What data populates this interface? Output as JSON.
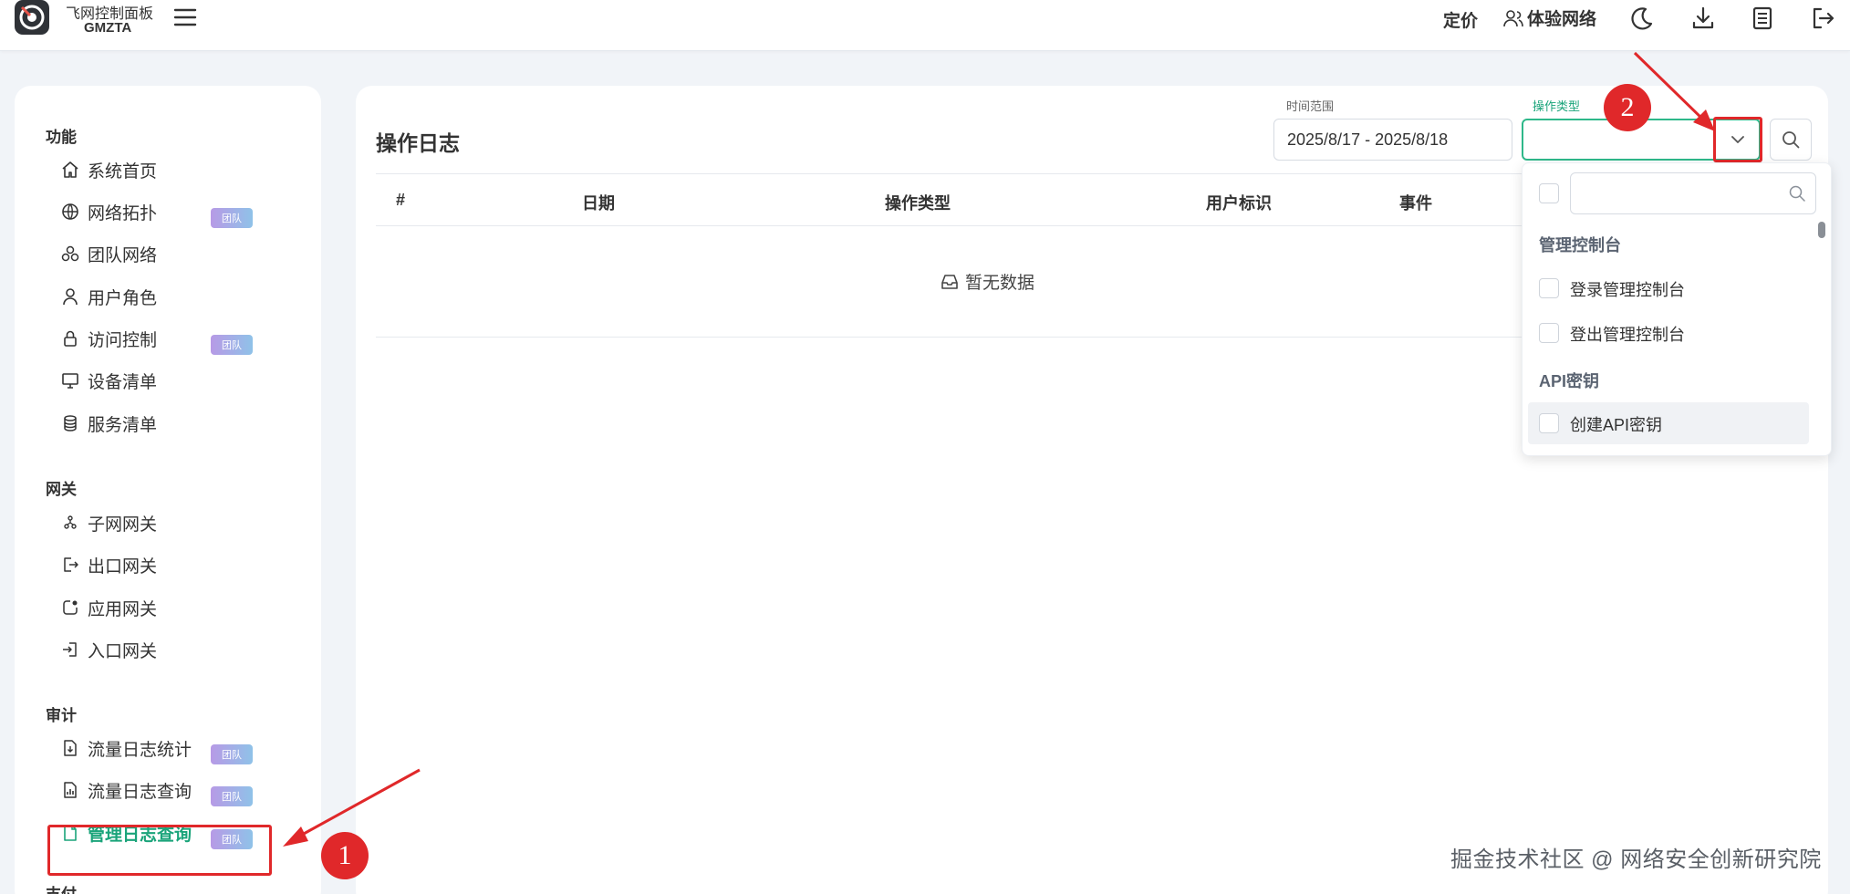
{
  "header": {
    "brand_line1": "飞网控制面板",
    "brand_line2": "GMZTA",
    "nav_pricing": "定价",
    "nav_trial": "体验网络"
  },
  "sidebar": {
    "sections": [
      {
        "title": "功能"
      },
      {
        "title": "网关"
      },
      {
        "title": "审计"
      },
      {
        "title": "支付"
      }
    ],
    "items": [
      {
        "label": "系统首页",
        "icon": "home-icon"
      },
      {
        "label": "网络拓扑",
        "icon": "globe-icon",
        "badge": "团队"
      },
      {
        "label": "团队网络",
        "icon": "network-icon"
      },
      {
        "label": "用户角色",
        "icon": "user-icon"
      },
      {
        "label": "访问控制",
        "icon": "lock-icon",
        "badge": "团队"
      },
      {
        "label": "设备清单",
        "icon": "monitor-icon"
      },
      {
        "label": "服务清单",
        "icon": "database-icon"
      },
      {
        "label": "子网网关",
        "icon": "subnet-icon"
      },
      {
        "label": "出口网关",
        "icon": "exit-icon"
      },
      {
        "label": "应用网关",
        "icon": "app-icon"
      },
      {
        "label": "入口网关",
        "icon": "entry-icon"
      },
      {
        "label": "流量日志统计",
        "icon": "file-download-icon",
        "badge": "团队"
      },
      {
        "label": "流量日志查询",
        "icon": "file-chart-icon",
        "badge": "团队"
      },
      {
        "label": "管理日志查询",
        "icon": "file-icon",
        "badge": "团队",
        "active": true
      }
    ]
  },
  "main": {
    "title": "操作日志",
    "time_label": "时间范围",
    "time_value": "2025/8/17 - 2025/8/18",
    "op_label": "操作类型",
    "columns": [
      "#",
      "日期",
      "操作类型",
      "用户标识",
      "事件"
    ],
    "empty_text": "暂无数据"
  },
  "dropdown": {
    "groups": [
      {
        "title": "管理控制台",
        "options": [
          "登录管理控制台",
          "登出管理控制台"
        ]
      },
      {
        "title": "API密钥",
        "options": [
          "创建API密钥"
        ]
      }
    ]
  },
  "annotations": {
    "step1": "1",
    "step2": "2",
    "accent": "#e0282a"
  },
  "watermark": "掘金技术社区 @ 网络安全创新研究院",
  "colors": {
    "accent_green": "#1aa47a",
    "badge_gradient": [
      "#b79ae6",
      "#8fc2e8"
    ]
  }
}
